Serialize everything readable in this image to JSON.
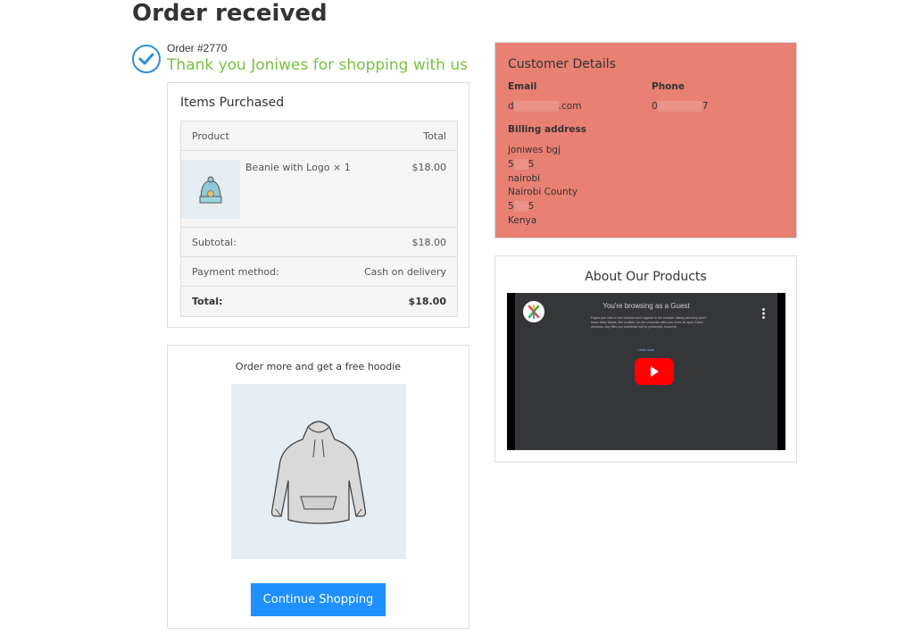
{
  "page": {
    "title": "Order received"
  },
  "order": {
    "number": "Order #2770",
    "thanks": "Thank you Joniwes for shopping with us"
  },
  "items": {
    "title": "Items Purchased",
    "header_product": "Product",
    "header_total": "Total",
    "product_name": "Beanie with Logo × 1",
    "product_price": "$18.00",
    "subtotal_label": "Subtotal:",
    "subtotal_value": "$18.00",
    "payment_label": "Payment method:",
    "payment_value": "Cash on delivery",
    "total_label": "Total:",
    "total_value": "$18.00"
  },
  "promo": {
    "text": "Order more and get a free hoodie",
    "button": "Continue Shopping"
  },
  "customer": {
    "title": "Customer Details",
    "email_label": "Email",
    "email_start": "d",
    "email_end": ".com",
    "phone_label": "Phone",
    "phone_start": "0",
    "phone_end": "7",
    "billing_label": "Billing address",
    "address_line1": "joniwes bgj",
    "address_line2_start": "5",
    "address_line2_end": "5",
    "address_city": "nairobi",
    "address_county": "Nairobi County",
    "address_postcode_start": "5",
    "address_postcode_end": "5",
    "address_country": "Kenya"
  },
  "about": {
    "title": "About Our Products",
    "video_heading": "You're browsing as a Guest",
    "video_text": "Pages you view in this window won't appear in the browser history and they won't leave other traces, like cookies, on the computer after you close all open Guest windows. Any files you download will be preserved, however.",
    "video_link": "Learn more"
  },
  "colors": {
    "accent": "#1e90ff",
    "success": "#7ac142",
    "customer_bg": "#e88073",
    "youtube": "#ff0000"
  }
}
